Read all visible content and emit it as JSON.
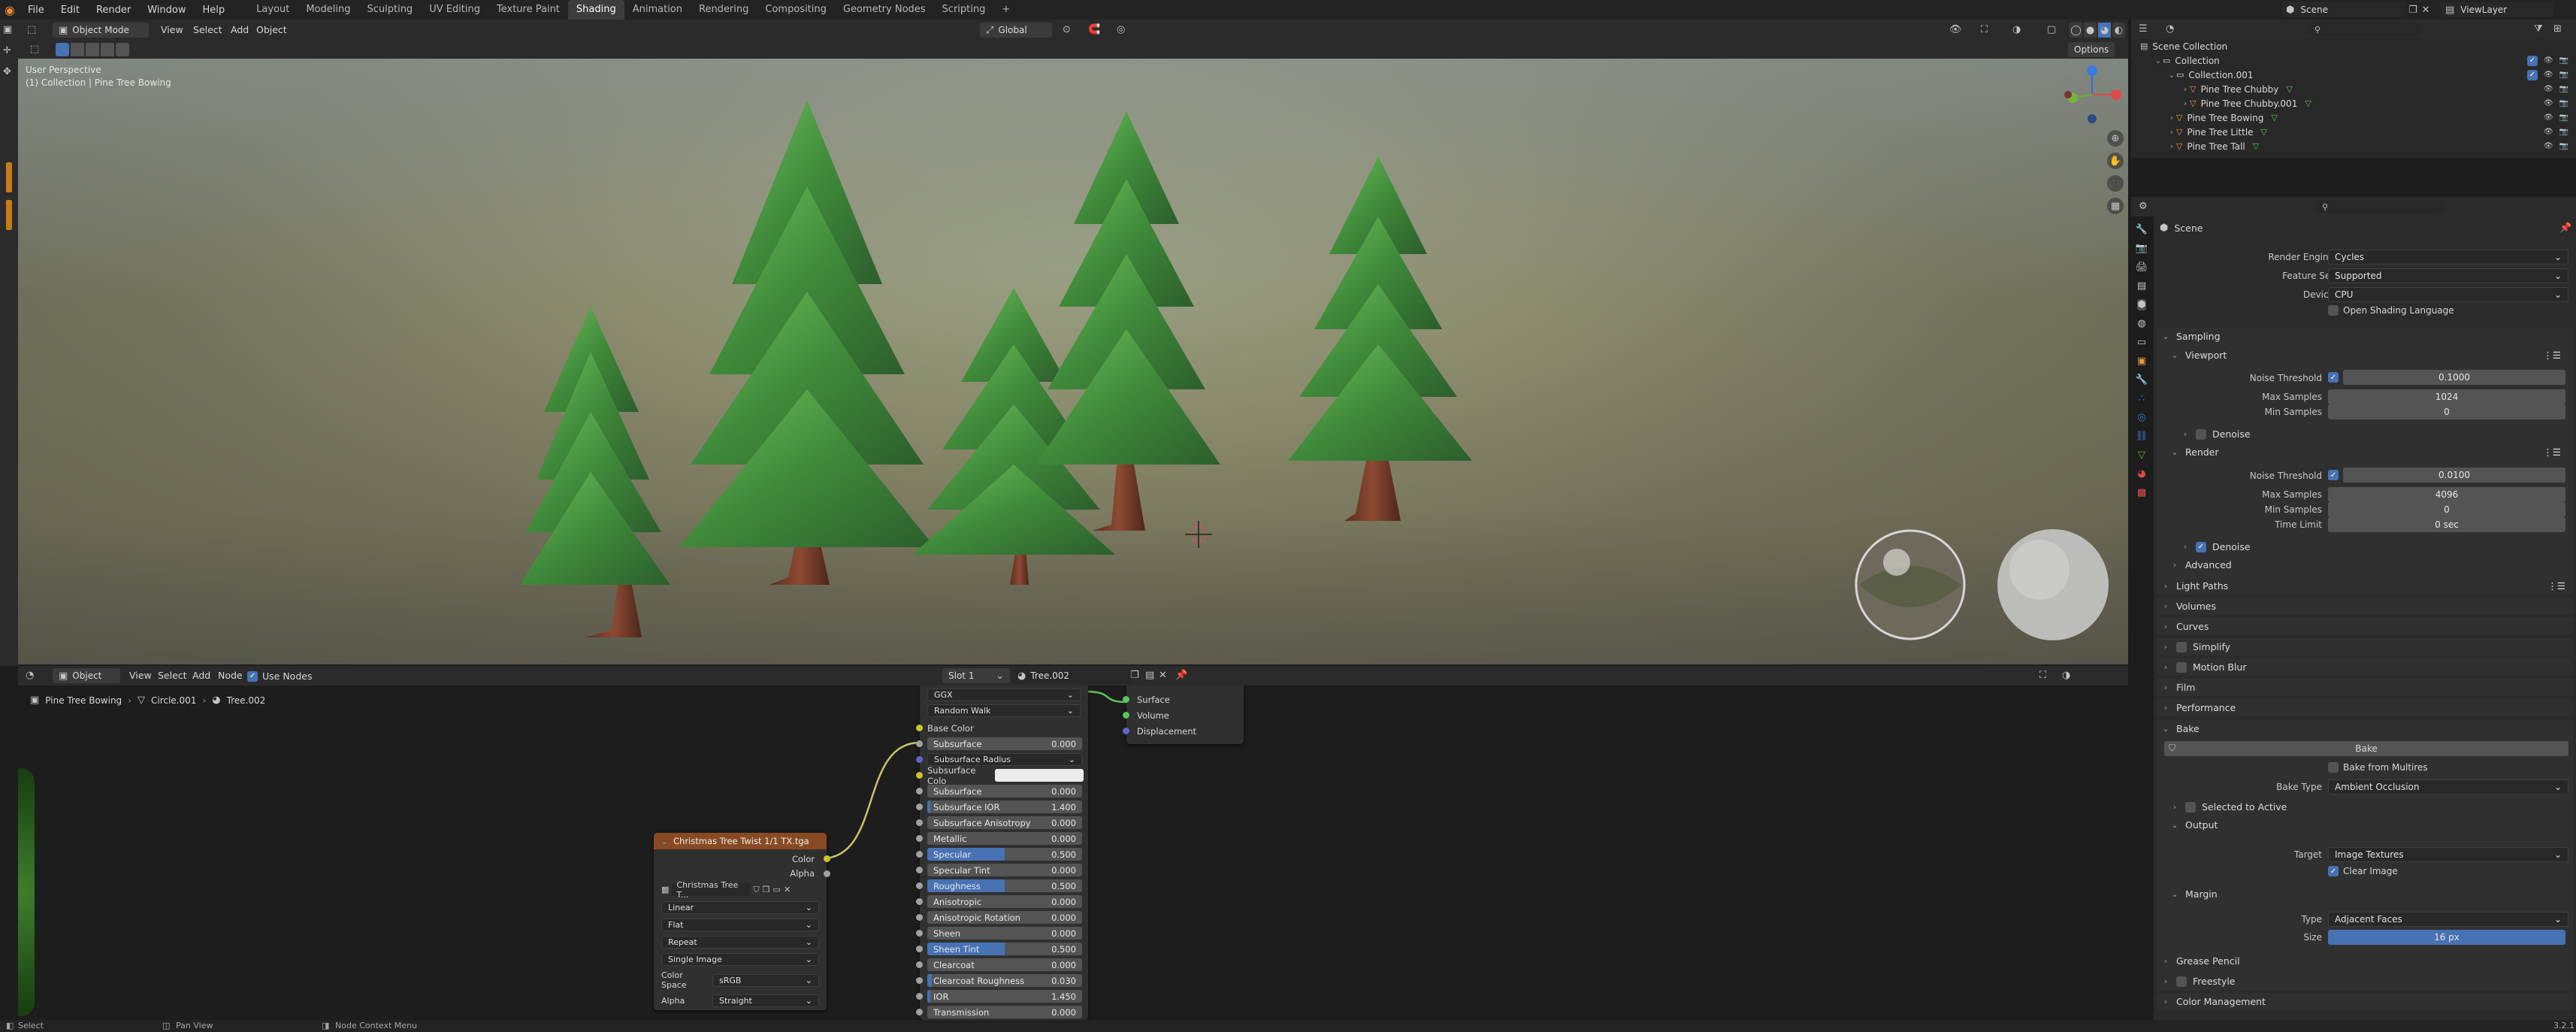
{
  "topbar": {
    "menus": [
      "File",
      "Edit",
      "Render",
      "Window",
      "Help"
    ],
    "workspaces": [
      "Layout",
      "Modeling",
      "Sculpting",
      "UV Editing",
      "Texture Paint",
      "Shading",
      "Animation",
      "Rendering",
      "Compositing",
      "Geometry Nodes",
      "Scripting"
    ],
    "active_workspace": "Shading",
    "add_tab": "+",
    "scene": "Scene",
    "view_layer": "ViewLayer"
  },
  "viewport": {
    "mode": "Object Mode",
    "menus": [
      "View",
      "Select",
      "Add",
      "Object"
    ],
    "orientation": "Global",
    "options": "Options",
    "overlay_title": "User Perspective",
    "overlay_subtitle": "(1) Collection | Pine Tree Bowing",
    "gizmo_axes": [
      "X",
      "Y",
      "Z"
    ]
  },
  "node_editor": {
    "editor_type": "Object",
    "menus": [
      "View",
      "Select",
      "Add",
      "Node"
    ],
    "use_nodes": "Use Nodes",
    "slot": "Slot 1",
    "material": "Tree.002",
    "breadcrumb": [
      "Pine Tree Bowing",
      "Circle.001",
      "Tree.002"
    ],
    "image_node": {
      "title": "Christmas Tree Twist 1/1 TX.tga",
      "outputs": [
        "Color",
        "Alpha"
      ],
      "image_name": "Christmas Tree T...",
      "interpolation": "Linear",
      "projection": "Flat",
      "extension": "Repeat",
      "source": "Single Image",
      "color_space_label": "Color Space",
      "color_space": "sRGB",
      "alpha_label": "Alpha",
      "alpha": "Straight"
    },
    "bsdf_node": {
      "distribution": "GGX",
      "subsurface_method": "Random Walk",
      "base_color": "Base Color",
      "subsurface_radius": "Subsurface Radius",
      "subsurface_color": "Subsurface Colo",
      "params": [
        {
          "name": "Subsurface",
          "value": "0.000",
          "fill": 0
        },
        {
          "name": "Subsurface IOR",
          "value": "1.400",
          "fill": 0.02
        },
        {
          "name": "Subsurface Anisotropy",
          "value": "0.000",
          "fill": 0
        },
        {
          "name": "Metallic",
          "value": "0.000",
          "fill": 0
        },
        {
          "name": "Specular",
          "value": "0.500",
          "fill": 0.5
        },
        {
          "name": "Specular Tint",
          "value": "0.000",
          "fill": 0
        },
        {
          "name": "Roughness",
          "value": "0.500",
          "fill": 0.5
        },
        {
          "name": "Anisotropic",
          "value": "0.000",
          "fill": 0
        },
        {
          "name": "Anisotropic Rotation",
          "value": "0.000",
          "fill": 0
        },
        {
          "name": "Sheen",
          "value": "0.000",
          "fill": 0
        },
        {
          "name": "Sheen Tint",
          "value": "0.500",
          "fill": 0.5
        },
        {
          "name": "Clearcoat",
          "value": "0.000",
          "fill": 0
        },
        {
          "name": "Clearcoat Roughness",
          "value": "0.030",
          "fill": 0.03
        },
        {
          "name": "IOR",
          "value": "1.450",
          "fill": 0.02
        },
        {
          "name": "Transmission",
          "value": "0.000",
          "fill": 0
        }
      ]
    },
    "output_node": {
      "inputs": [
        "Surface",
        "Volume",
        "Displacement"
      ]
    }
  },
  "outliner": {
    "root": "Scene Collection",
    "items": [
      {
        "label": "Collection",
        "depth": 1
      },
      {
        "label": "Collection.001",
        "depth": 2
      },
      {
        "label": "Pine Tree Chubby",
        "depth": 3
      },
      {
        "label": "Pine Tree Chubby.001",
        "depth": 3
      },
      {
        "label": "Pine Tree Bowing",
        "depth": 2
      },
      {
        "label": "Pine Tree Little",
        "depth": 2
      },
      {
        "label": "Pine Tree Tall",
        "depth": 2
      }
    ]
  },
  "properties": {
    "context": "Scene",
    "render_engine_label": "Render Engine",
    "render_engine": "Cycles",
    "feature_set_label": "Feature Set",
    "feature_set": "Supported",
    "device_label": "Device",
    "device": "CPU",
    "osl": "Open Shading Language",
    "sampling": "Sampling",
    "viewport": "Viewport",
    "noise_threshold_label": "Noise Threshold",
    "vp_noise": "0.1000",
    "max_samples_label": "Max Samples",
    "vp_max": "1024",
    "min_samples_label": "Min Samples",
    "vp_min": "0",
    "denoise": "Denoise",
    "render": "Render",
    "r_noise": "0.0100",
    "r_max": "4096",
    "r_min": "0",
    "time_limit_label": "Time Limit",
    "r_time": "0 sec",
    "advanced": "Advanced",
    "sections_mid": [
      "Light Paths",
      "Volumes",
      "Curves",
      "Simplify",
      "Motion Blur",
      "Film",
      "Performance"
    ],
    "bake": "Bake",
    "bake_button": "Bake",
    "bake_multires": "Bake from Multires",
    "bake_type_label": "Bake Type",
    "bake_type": "Ambient Occlusion",
    "selected_to_active": "Selected to Active",
    "output": "Output",
    "target_label": "Target",
    "target": "Image Textures",
    "clear_image": "Clear Image",
    "margin": "Margin",
    "type_label": "Type",
    "margin_type": "Adjacent Faces",
    "size_label": "Size",
    "margin_size": "16 px",
    "sections_end": [
      "Grease Pencil",
      "Freestyle",
      "Color Management"
    ]
  },
  "statusbar": {
    "select": "Select",
    "pan": "Pan View",
    "context_menu": "Node Context Menu",
    "version": "3.2.1"
  }
}
